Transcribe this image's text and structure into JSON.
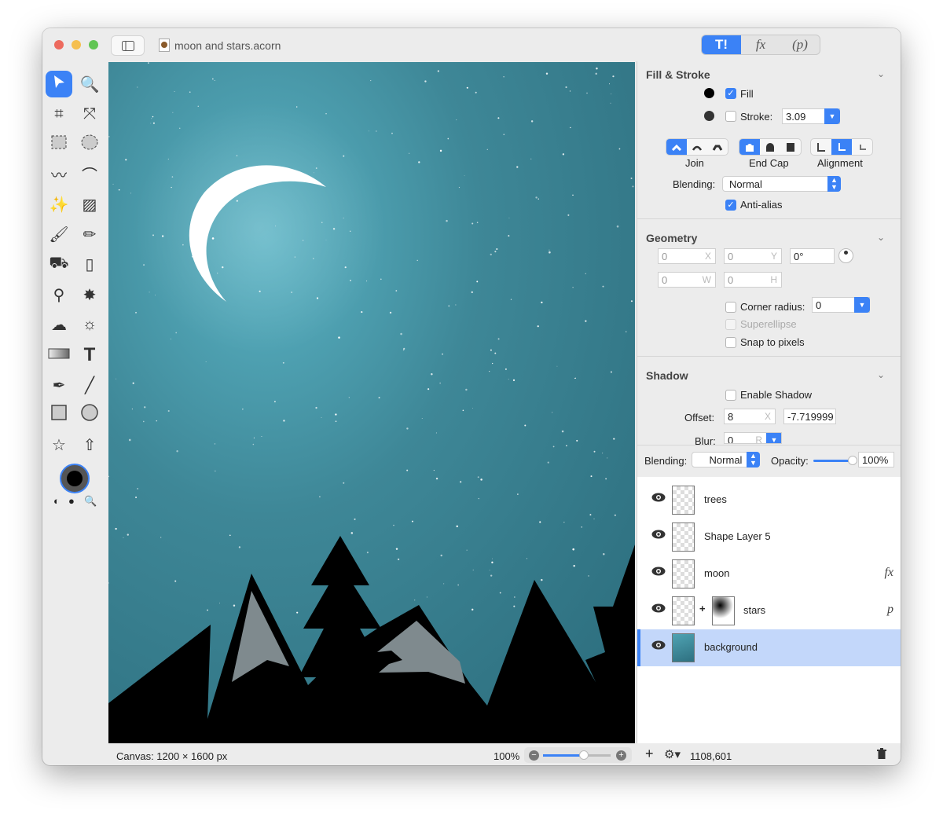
{
  "window": {
    "title": "moon and stars.acorn"
  },
  "toolbar": {
    "segments": [
      {
        "name": "tools",
        "label": "T!"
      },
      {
        "name": "effects",
        "label": "fx"
      },
      {
        "name": "plugins",
        "label": "(p)"
      }
    ],
    "active": "tools"
  },
  "tools": [
    "select",
    "zoom",
    "crop",
    "transform",
    "rect-select",
    "ellipse-select",
    "lasso",
    "polygon-lasso",
    "magic-wand",
    "color-select",
    "brush",
    "pencil",
    "paint-bucket",
    "eraser",
    "clone-stamp",
    "smudge",
    "cloud",
    "brightness",
    "gradient",
    "text",
    "pen",
    "line",
    "rectangle",
    "ellipse",
    "star",
    "arrow"
  ],
  "fill_stroke": {
    "title": "Fill & Stroke",
    "fill_label": "Fill",
    "fill_checked": true,
    "fill_color": "#000000",
    "stroke_label": "Stroke:",
    "stroke_checked": false,
    "stroke_color": "#333333",
    "stroke_width": "3.09",
    "join_label": "Join",
    "endcap_label": "End Cap",
    "alignment_label": "Alignment",
    "blending_label": "Blending:",
    "blending_value": "Normal",
    "antialias_label": "Anti-alias",
    "antialias_checked": true
  },
  "geometry": {
    "title": "Geometry",
    "x": "0",
    "x_suffix": "X",
    "y": "0",
    "y_suffix": "Y",
    "rotation": "0°",
    "w": "0",
    "w_suffix": "W",
    "h": "0",
    "h_suffix": "H",
    "corner_label": "Corner radius:",
    "corner_value": "0",
    "superellipse_label": "Superellipse",
    "snap_label": "Snap to pixels"
  },
  "shadow": {
    "title": "Shadow",
    "enable_label": "Enable Shadow",
    "offset_label": "Offset:",
    "offset_x": "8",
    "offset_x_suffix": "X",
    "offset_y": "-7.719999",
    "blur_label": "Blur:",
    "blur_value": "0",
    "blur_suffix": "R"
  },
  "layer_props": {
    "blending_label": "Blending:",
    "blending_value": "Normal",
    "opacity_label": "Opacity:",
    "opacity_value": "100%",
    "opacity": 1.0
  },
  "layers": [
    {
      "name": "trees",
      "badge": ""
    },
    {
      "name": "Shape Layer 5",
      "badge": ""
    },
    {
      "name": "moon",
      "badge": "fx"
    },
    {
      "name": "stars",
      "badge": "p"
    },
    {
      "name": "background",
      "badge": "",
      "selected": true
    }
  ],
  "status": {
    "canvas_info": "Canvas: 1200 × 1600 px",
    "zoom": "100%",
    "zoom_fraction": 0.6,
    "coords": "1108,601"
  },
  "colors": {
    "accent": "#3b82f6",
    "sky": "#3a7f8f",
    "moon": "#ffffff",
    "selection": "#c3d7fa"
  }
}
